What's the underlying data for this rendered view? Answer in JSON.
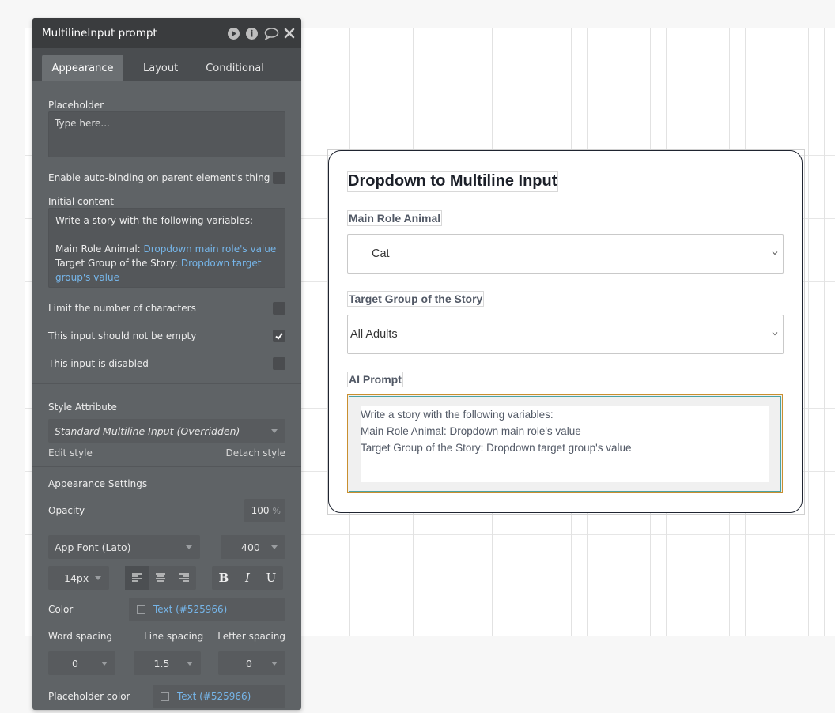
{
  "panel": {
    "title": "MultilineInput prompt",
    "tabs": [
      "Appearance",
      "Layout",
      "Conditional"
    ],
    "placeholder_label": "Placeholder",
    "placeholder_value": "Type here...",
    "auto_binding_label": "Enable auto-binding on parent element's thing",
    "initial_content_label": "Initial content",
    "initial_content": {
      "line1": "Write a story with the following variables:",
      "line2_prefix": "Main Role Animal: ",
      "line2_dyn": "Dropdown main role's value",
      "line3_prefix": "Target Group of the Story: ",
      "line3_dyn_a": "Dropdown target",
      "line3_dyn_b": "group's value"
    },
    "limit_chars_label": "Limit the number of characters",
    "not_empty_label": "This input should not be empty",
    "disabled_label": "This input is disabled",
    "style_attribute_label": "Style Attribute",
    "style_value": "Standard Multiline Input (Overridden)",
    "edit_style": "Edit style",
    "detach_style": "Detach style",
    "appearance_settings_label": "Appearance Settings",
    "opacity_label": "Opacity",
    "opacity_value": "100",
    "opacity_unit": "%",
    "font_family": "App Font (Lato)",
    "font_weight": "400",
    "font_size": "14px",
    "bold_label": "B",
    "italic_label": "I",
    "underline_label": "U",
    "color_label": "Color",
    "color_value": "Text (#525966)",
    "word_spacing_label": "Word spacing",
    "line_spacing_label": "Line spacing",
    "letter_spacing_label": "Letter spacing",
    "word_spacing_value": "0",
    "line_spacing_value": "1.5",
    "letter_spacing_value": "0",
    "placeholder_color_label": "Placeholder color",
    "placeholder_color_value": "Text (#525966)",
    "not_empty_checked": true,
    "text_color_hex": "#525966"
  },
  "card": {
    "title": "Dropdown to Multiline Input",
    "main_role_label": "Main Role Animal",
    "main_role_value": "Cat",
    "target_group_label": "Target Group of the Story",
    "target_group_value": "All Adults",
    "ai_prompt_label": "AI Prompt",
    "ai_prompt_lines": [
      "Write a story with the following variables:",
      "",
      "Main Role Animal: Dropdown main role's value",
      "Target Group of the Story: Dropdown target group's value"
    ]
  }
}
